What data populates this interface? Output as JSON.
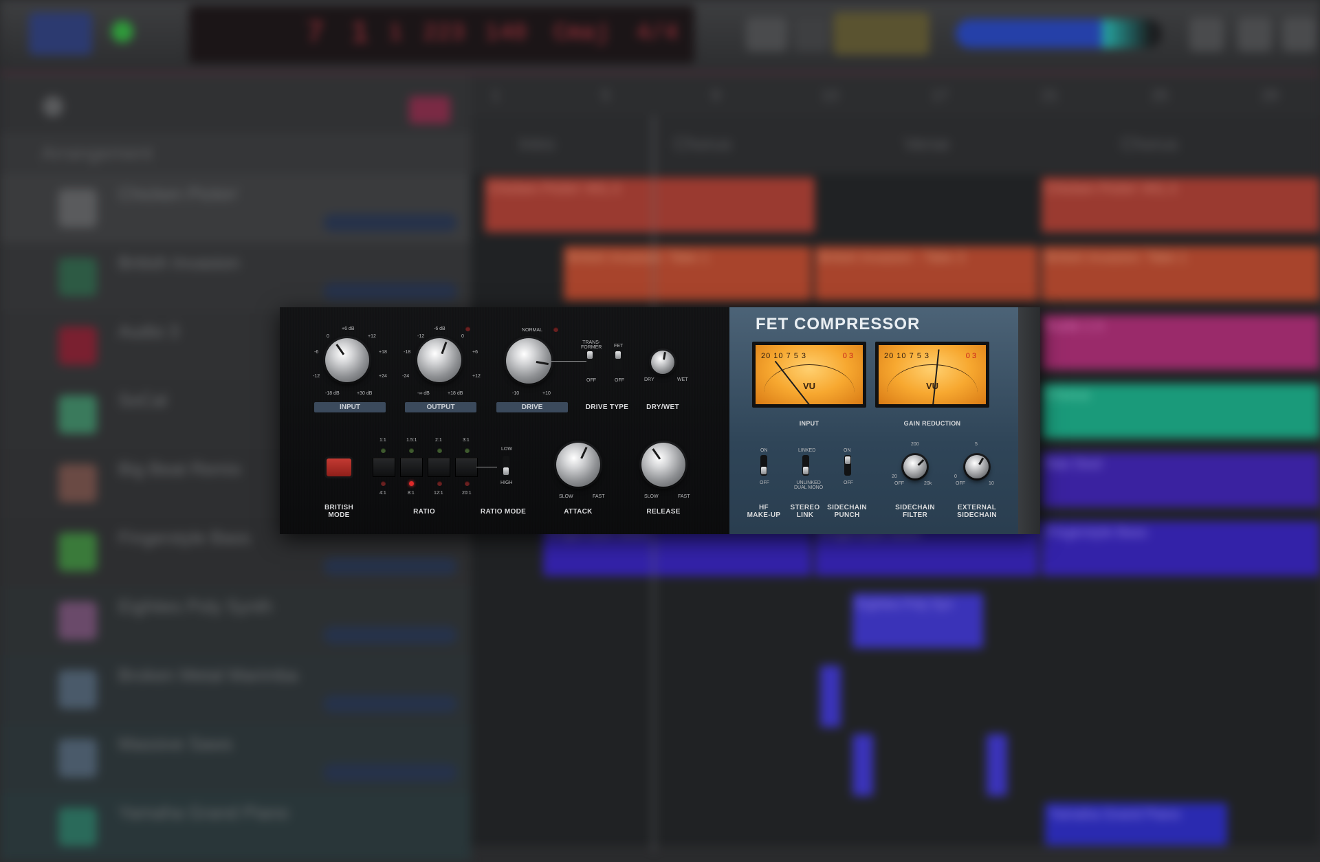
{
  "daw": {
    "lcd": {
      "bar": "7",
      "beat": "1",
      "div": "1",
      "tick": "223",
      "tempo": "140",
      "key": "Cmaj",
      "sig": "4/4"
    },
    "arrangement_label": "Arrangement",
    "ruler": [
      "1",
      "5",
      "9",
      "13",
      "17",
      "21",
      "25",
      "29"
    ],
    "sections": [
      "Intro",
      "Chorus",
      "Verse",
      "Chorus"
    ],
    "tracks": [
      {
        "name": "Chicken Pickin'",
        "color": "#5a5b5d"
      },
      {
        "name": "British Invasion",
        "color": "#2d5a44"
      },
      {
        "name": "Audio 3",
        "color": "#7a2030"
      },
      {
        "name": "SoCal",
        "color": "#3a7a5c"
      },
      {
        "name": "Big Beat Remix",
        "color": "#6a4a44"
      },
      {
        "name": "Fingerstyle Bass",
        "color": "#3a7a3a"
      },
      {
        "name": "Eighties Poly Synth",
        "color": "#6a4a6a"
      },
      {
        "name": "Broken Metal Marimba",
        "color": "#4a5a6a"
      },
      {
        "name": "Massive Saws",
        "color": "#4a5a6a"
      },
      {
        "name": "Yamaha Grand Piano",
        "color": "#2a6a5a"
      }
    ],
    "regions": {
      "chicken1": "Chicken Pickin' #01.3",
      "chicken2": "Chicken Pickin' #01.3",
      "brit1": "British Invasion: Take 1",
      "brit2": "British Invasion - Take 3",
      "brit3": "British Invasion: Take 1",
      "audio": "Audio 1.5",
      "socal": "Chorus",
      "bigbeat": "Nas Soul",
      "bass1": "Fingerstyle Bass",
      "bass2": "Fingerstyle Bass",
      "bass3": "Fingerstyle Bass",
      "poly": "Eighties Poly Syn",
      "piano": "Yamaha Grand Piano"
    }
  },
  "plugin": {
    "title": "FET COMPRESSOR",
    "knobs": {
      "input": {
        "label": "INPUT",
        "min": "-18 dB",
        "max": "+30 dB",
        "scale": [
          "-12",
          "-6",
          "0",
          "+6 dB",
          "+12",
          "+18",
          "+24"
        ]
      },
      "output": {
        "label": "OUTPUT",
        "min": "-∞ dB",
        "max": "+18 dB",
        "scale": [
          "-24",
          "-18",
          "-12",
          "-6 dB",
          "0",
          "+6",
          "+12"
        ]
      },
      "drive": {
        "label": "DRIVE",
        "min": "-10",
        "max": "+10",
        "normal": "NORMAL"
      },
      "dry_wet": {
        "label": "DRY/WET",
        "min": "DRY",
        "max": "WET"
      },
      "attack": {
        "label": "ATTACK",
        "min": "SLOW",
        "max": "FAST"
      },
      "release": {
        "label": "RELEASE",
        "min": "SLOW",
        "max": "FAST"
      },
      "sidechain_filter": {
        "label": "SIDECHAIN\nFILTER",
        "min": "OFF",
        "max": "20k",
        "top": "200",
        "left": "20"
      },
      "external_sidechain": {
        "label": "EXTERNAL\nSIDECHAIN",
        "min": "OFF",
        "max": "10",
        "top": "5",
        "left": "0"
      }
    },
    "drive_type": {
      "label": "DRIVE TYPE",
      "transformer": "TRANS-\nFORMER",
      "fet": "FET",
      "off1": "OFF",
      "off2": "OFF"
    },
    "british_mode": {
      "label": "BRITISH\nMODE"
    },
    "ratio": {
      "label": "RATIO",
      "top": [
        "1:1",
        "1.5:1",
        "2:1",
        "3:1"
      ],
      "bottom": [
        "4:1",
        "8:1",
        "12:1",
        "20:1"
      ],
      "active": "8:1"
    },
    "ratio_mode": {
      "label": "RATIO MODE",
      "low": "LOW",
      "high": "HIGH"
    },
    "meters": {
      "input": {
        "label": "INPUT",
        "vu": "VU",
        "scale": "20 10 7 5 3",
        "red": "0  3"
      },
      "gain_reduction": {
        "label": "GAIN REDUCTION",
        "vu": "VU",
        "scale": "20 10 7 5 3",
        "red": "0  3"
      }
    },
    "switches": {
      "hf_makeup": {
        "label": "HF\nMAKE-UP",
        "on": "ON",
        "off": "OFF"
      },
      "stereo_link": {
        "label": "STEREO\nLINK",
        "on": "LINKED",
        "off": "UNLINKED\nDUAL MONO"
      },
      "sidechain_punch": {
        "label": "SIDECHAIN\nPUNCH",
        "on": "ON",
        "off": "OFF"
      }
    }
  }
}
